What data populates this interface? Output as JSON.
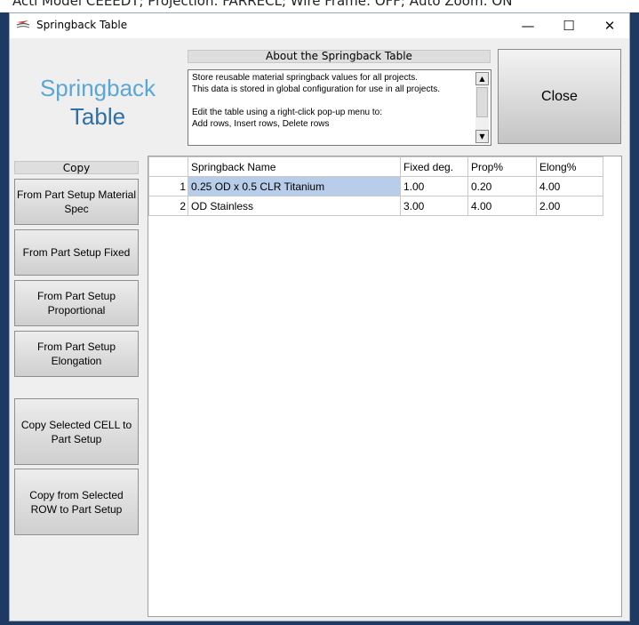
{
  "background": {
    "partial_text": "Acti Model CEEEDT; Projection: FARRECL; Wire Frame: OFF; Auto Zoom: ON"
  },
  "window": {
    "title": "Springback Table",
    "icon": "app-icon",
    "controls": {
      "minimize": "—",
      "maximize": "☐",
      "close": "✕"
    }
  },
  "logo": {
    "line1": "Springback",
    "line2": "Table"
  },
  "about": {
    "header": "About the Springback Table",
    "text": "Store reusable material springback values for all projects.\nThis data is stored in global configuration for use in all projects.\n\nEdit the table using a right-click pop-up menu to:\nAdd rows, Insert rows, Delete rows"
  },
  "close_button": "Close",
  "copy": {
    "header": "Copy",
    "buttons": [
      "From Part Setup Material Spec",
      "From Part Setup Fixed",
      "From Part Setup Proportional",
      "From Part Setup Elongation",
      "Copy Selected CELL to Part Setup",
      "Copy from Selected ROW to Part Setup"
    ]
  },
  "table": {
    "columns": [
      "",
      "Springback Name",
      "Fixed deg.",
      "Prop%",
      "Elong%"
    ],
    "rows": [
      [
        "1",
        "0.25 OD x 0.5 CLR Titanium",
        "1.00",
        "0.20",
        "4.00"
      ],
      [
        "2",
        "OD Stainless",
        "3.00",
        "4.00",
        "2.00"
      ]
    ],
    "selected_cell": "row 1, Springback Name",
    "selection_color": "#b8cde9"
  }
}
